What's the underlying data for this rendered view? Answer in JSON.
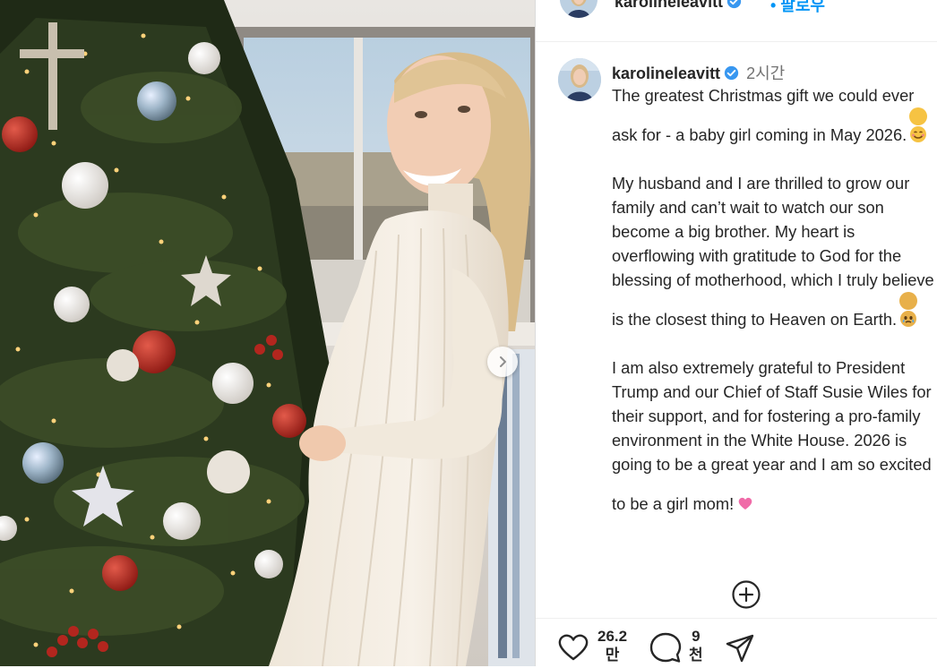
{
  "header": {
    "username": "karolineleavitt",
    "follow_label": "• 팔로우"
  },
  "post": {
    "username": "karolineleavitt",
    "time": "2시간",
    "caption": {
      "p1": "The greatest Christmas gift we could ever ask for - a baby girl coming in May 2026.",
      "p2": "My husband and I are thrilled to grow our family and can’t wait to watch our son become a big brother. My heart is overflowing with gratitude to God for the blessing of motherhood, which I truly believe is the closest thing to Heaven on Earth.",
      "p3": "I am also extremely grateful to President Trump and our Chief of Staff Susie Wiles for their support, and for fostering a pro-family environment in the White House. 2026 is going to be a great year and I am so excited to be a girl mom!"
    }
  },
  "actions": {
    "likes_line1": "26.2",
    "likes_line2": "만",
    "comments_line1": "9",
    "comments_line2": "천"
  },
  "icons": {
    "like": "heart-icon",
    "comment": "comment-icon",
    "share": "share-icon",
    "more": "plus-circle-icon",
    "next": "chevron-right-icon",
    "verified": "verified-badge-icon"
  },
  "colors": {
    "accent": "#0095f6",
    "verified": "#3897f0"
  }
}
